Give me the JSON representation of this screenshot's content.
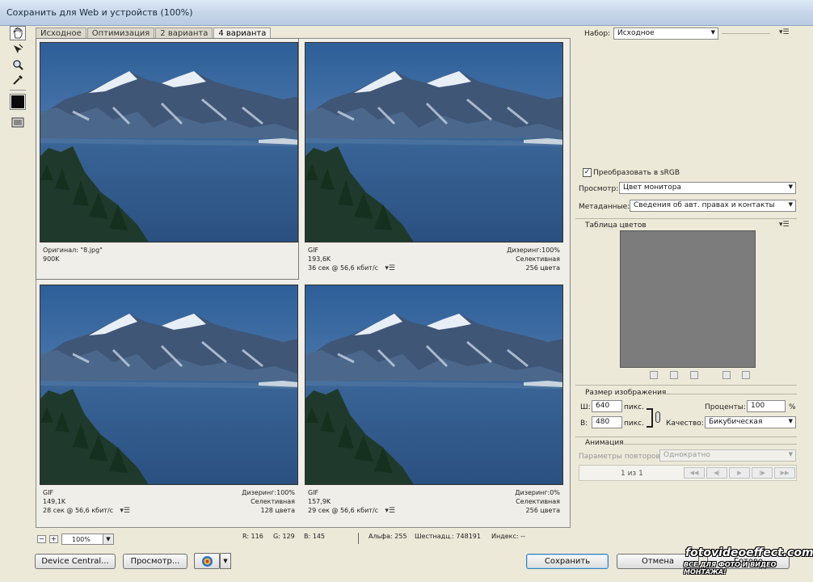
{
  "window": {
    "title": "Сохранить для Web и устройств (100%)"
  },
  "toolbar": {
    "tools": [
      "hand-icon",
      "slice-select-icon",
      "zoom-icon",
      "eyedropper-icon"
    ]
  },
  "tabs": [
    {
      "label": "Исходное",
      "active": false
    },
    {
      "label": "Оптимизация",
      "active": false
    },
    {
      "label": "2 варианта",
      "active": false
    },
    {
      "label": "4 варианта",
      "active": true
    }
  ],
  "previews": [
    {
      "left_lines": [
        "Оригинал: \"8.jpg\"",
        "900K"
      ],
      "right_lines": []
    },
    {
      "left_lines": [
        "GIF",
        "193,6K",
        "36 сек @ 56,6 кбит/с"
      ],
      "right_lines": [
        "Дизеринг:100%",
        "Селективная",
        "256 цвета"
      ]
    },
    {
      "left_lines": [
        "GIF",
        "149,1K",
        "28 сек @ 56,6 кбит/с"
      ],
      "right_lines": [
        "Дизеринг:100%",
        "Селективная",
        "128 цвета"
      ]
    },
    {
      "left_lines": [
        "GIF",
        "157,9K",
        "29 сек @ 56,6 кбит/с"
      ],
      "right_lines": [
        "Дизеринг:0%",
        "Селективная",
        "256 цвета"
      ]
    }
  ],
  "status": {
    "zoom": "100%",
    "r": "R: 116",
    "g": "G: 129",
    "b": "B: 145",
    "alpha": "Альфа: 255",
    "hex": "Шестнадц.: 748191",
    "index": "Индекс: --"
  },
  "buttons": {
    "device_central": "Device Central...",
    "preview": "Просмотр...",
    "save": "Сохранить",
    "cancel": "Отмена",
    "done": "Готово"
  },
  "right": {
    "preset_label": "Набор:",
    "preset_value": "Исходное",
    "convert_srgb": "Преобразовать в sRGB",
    "convert_srgb_checked": true,
    "preview_label": "Просмотр:",
    "preview_value": "Цвет монитора",
    "metadata_label": "Метаданные:",
    "metadata_value": "Сведения об авт. правах и контакты",
    "color_table_title": "Таблица цветов",
    "image_size_title": "Размер изображения",
    "w_label": "Ш:",
    "w_value": "640",
    "w_unit": "пикс.",
    "h_label": "В:",
    "h_value": "480",
    "h_unit": "пикс.",
    "percent_label": "Проценты:",
    "percent_value": "100",
    "percent_unit": "%",
    "quality_label": "Качество:",
    "quality_value": "Бикубическая",
    "animation_title": "Анимация",
    "loop_label": "Параметры повторов:",
    "loop_value": "Однократно",
    "frame_counter": "1 из 1"
  },
  "watermark": {
    "line1": "fotovideoeffect.com",
    "line2": "ВСЕ ДЛЯ ФОТО И ВИДЕО МОНТАЖА!"
  },
  "colors": {
    "sky": "#3d6fa6",
    "water": "#2a5080",
    "mountain": "#3f5677",
    "forest": "#1f3a2c",
    "colortable": "#7c7c7c"
  }
}
